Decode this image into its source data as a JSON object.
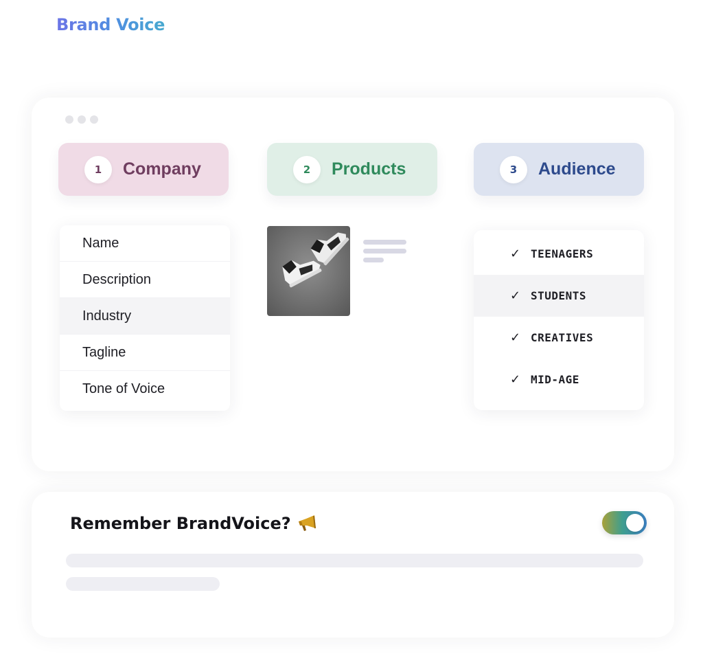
{
  "header": {
    "title": "Brand Voice"
  },
  "steps": [
    {
      "number": "1",
      "label": "Company"
    },
    {
      "number": "2",
      "label": "Products"
    },
    {
      "number": "3",
      "label": "Audience"
    }
  ],
  "company": {
    "fields": [
      "Name",
      "Description",
      "Industry",
      "Tagline",
      "Tone of Voice"
    ],
    "selected": "Industry"
  },
  "products": {
    "image_icon": "sneaker-photo",
    "text_icon": "text-lines-icon"
  },
  "audience": {
    "items": [
      "TEENAGERS",
      "STUDENTS",
      "CREATIVES",
      "MID-AGE"
    ],
    "selected": "STUDENTS",
    "check_icon": "checkmark-icon"
  },
  "remember": {
    "title": "Remember BrandVoice?",
    "icon": "megaphone-icon",
    "toggle_on": true
  },
  "colors": {
    "title_gradient": [
      "#6b74e6",
      "#48a9cf"
    ],
    "company": "#6f3d5f",
    "company_bg": "#f0dbe6",
    "products": "#2f8a5c",
    "products_bg": "#e0efe7",
    "audience": "#2d4a8c",
    "audience_bg": "#dde3f0"
  }
}
